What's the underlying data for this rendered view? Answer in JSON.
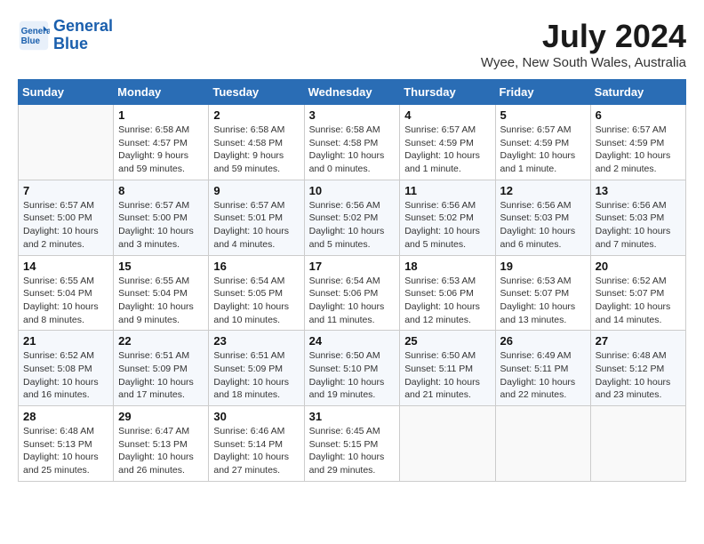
{
  "header": {
    "logo_line1": "General",
    "logo_line2": "Blue",
    "title": "July 2024",
    "subtitle": "Wyee, New South Wales, Australia"
  },
  "calendar": {
    "days_of_week": [
      "Sunday",
      "Monday",
      "Tuesday",
      "Wednesday",
      "Thursday",
      "Friday",
      "Saturday"
    ],
    "weeks": [
      [
        {
          "num": "",
          "info": ""
        },
        {
          "num": "1",
          "info": "Sunrise: 6:58 AM\nSunset: 4:57 PM\nDaylight: 9 hours\nand 59 minutes."
        },
        {
          "num": "2",
          "info": "Sunrise: 6:58 AM\nSunset: 4:58 PM\nDaylight: 9 hours\nand 59 minutes."
        },
        {
          "num": "3",
          "info": "Sunrise: 6:58 AM\nSunset: 4:58 PM\nDaylight: 10 hours\nand 0 minutes."
        },
        {
          "num": "4",
          "info": "Sunrise: 6:57 AM\nSunset: 4:59 PM\nDaylight: 10 hours\nand 1 minute."
        },
        {
          "num": "5",
          "info": "Sunrise: 6:57 AM\nSunset: 4:59 PM\nDaylight: 10 hours\nand 1 minute."
        },
        {
          "num": "6",
          "info": "Sunrise: 6:57 AM\nSunset: 4:59 PM\nDaylight: 10 hours\nand 2 minutes."
        }
      ],
      [
        {
          "num": "7",
          "info": "Sunrise: 6:57 AM\nSunset: 5:00 PM\nDaylight: 10 hours\nand 2 minutes."
        },
        {
          "num": "8",
          "info": "Sunrise: 6:57 AM\nSunset: 5:00 PM\nDaylight: 10 hours\nand 3 minutes."
        },
        {
          "num": "9",
          "info": "Sunrise: 6:57 AM\nSunset: 5:01 PM\nDaylight: 10 hours\nand 4 minutes."
        },
        {
          "num": "10",
          "info": "Sunrise: 6:56 AM\nSunset: 5:02 PM\nDaylight: 10 hours\nand 5 minutes."
        },
        {
          "num": "11",
          "info": "Sunrise: 6:56 AM\nSunset: 5:02 PM\nDaylight: 10 hours\nand 5 minutes."
        },
        {
          "num": "12",
          "info": "Sunrise: 6:56 AM\nSunset: 5:03 PM\nDaylight: 10 hours\nand 6 minutes."
        },
        {
          "num": "13",
          "info": "Sunrise: 6:56 AM\nSunset: 5:03 PM\nDaylight: 10 hours\nand 7 minutes."
        }
      ],
      [
        {
          "num": "14",
          "info": "Sunrise: 6:55 AM\nSunset: 5:04 PM\nDaylight: 10 hours\nand 8 minutes."
        },
        {
          "num": "15",
          "info": "Sunrise: 6:55 AM\nSunset: 5:04 PM\nDaylight: 10 hours\nand 9 minutes."
        },
        {
          "num": "16",
          "info": "Sunrise: 6:54 AM\nSunset: 5:05 PM\nDaylight: 10 hours\nand 10 minutes."
        },
        {
          "num": "17",
          "info": "Sunrise: 6:54 AM\nSunset: 5:06 PM\nDaylight: 10 hours\nand 11 minutes."
        },
        {
          "num": "18",
          "info": "Sunrise: 6:53 AM\nSunset: 5:06 PM\nDaylight: 10 hours\nand 12 minutes."
        },
        {
          "num": "19",
          "info": "Sunrise: 6:53 AM\nSunset: 5:07 PM\nDaylight: 10 hours\nand 13 minutes."
        },
        {
          "num": "20",
          "info": "Sunrise: 6:52 AM\nSunset: 5:07 PM\nDaylight: 10 hours\nand 14 minutes."
        }
      ],
      [
        {
          "num": "21",
          "info": "Sunrise: 6:52 AM\nSunset: 5:08 PM\nDaylight: 10 hours\nand 16 minutes."
        },
        {
          "num": "22",
          "info": "Sunrise: 6:51 AM\nSunset: 5:09 PM\nDaylight: 10 hours\nand 17 minutes."
        },
        {
          "num": "23",
          "info": "Sunrise: 6:51 AM\nSunset: 5:09 PM\nDaylight: 10 hours\nand 18 minutes."
        },
        {
          "num": "24",
          "info": "Sunrise: 6:50 AM\nSunset: 5:10 PM\nDaylight: 10 hours\nand 19 minutes."
        },
        {
          "num": "25",
          "info": "Sunrise: 6:50 AM\nSunset: 5:11 PM\nDaylight: 10 hours\nand 21 minutes."
        },
        {
          "num": "26",
          "info": "Sunrise: 6:49 AM\nSunset: 5:11 PM\nDaylight: 10 hours\nand 22 minutes."
        },
        {
          "num": "27",
          "info": "Sunrise: 6:48 AM\nSunset: 5:12 PM\nDaylight: 10 hours\nand 23 minutes."
        }
      ],
      [
        {
          "num": "28",
          "info": "Sunrise: 6:48 AM\nSunset: 5:13 PM\nDaylight: 10 hours\nand 25 minutes."
        },
        {
          "num": "29",
          "info": "Sunrise: 6:47 AM\nSunset: 5:13 PM\nDaylight: 10 hours\nand 26 minutes."
        },
        {
          "num": "30",
          "info": "Sunrise: 6:46 AM\nSunset: 5:14 PM\nDaylight: 10 hours\nand 27 minutes."
        },
        {
          "num": "31",
          "info": "Sunrise: 6:45 AM\nSunset: 5:15 PM\nDaylight: 10 hours\nand 29 minutes."
        },
        {
          "num": "",
          "info": ""
        },
        {
          "num": "",
          "info": ""
        },
        {
          "num": "",
          "info": ""
        }
      ]
    ]
  }
}
